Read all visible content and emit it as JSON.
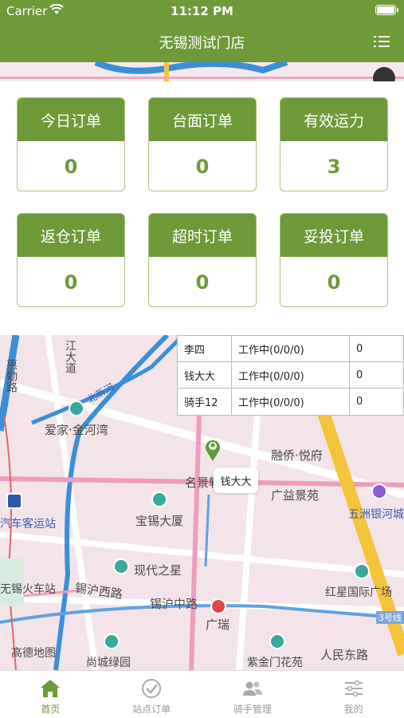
{
  "status_bar": {
    "carrier": "Carrier",
    "time": "11:12 PM"
  },
  "header": {
    "title": "无锡测试门店"
  },
  "stats": [
    {
      "label": "今日订单",
      "value": "0"
    },
    {
      "label": "台面订单",
      "value": "0"
    },
    {
      "label": "有效运力",
      "value": "3"
    },
    {
      "label": "返仓订单",
      "value": "0"
    },
    {
      "label": "超时订单",
      "value": "0"
    },
    {
      "label": "妥投订单",
      "value": "0"
    }
  ],
  "riders": [
    {
      "name": "李四",
      "status": "工作中(0/0/0)",
      "count": "0"
    },
    {
      "name": "钱大大",
      "status": "工作中(0/0/0)",
      "count": "0"
    },
    {
      "name": "骑手12",
      "status": "工作中(0/0/0)",
      "count": "0"
    }
  ],
  "map": {
    "rider_marker_label": "钱大大",
    "logo": "高德地图",
    "places": [
      {
        "text": "惠勤路"
      },
      {
        "text": "江大道"
      },
      {
        "text": "北新河"
      },
      {
        "text": "爱家·金河湾"
      },
      {
        "text": "融侨·悦府"
      },
      {
        "text": "名景轩"
      },
      {
        "text": "广益景苑"
      },
      {
        "text": "五洲银河城"
      },
      {
        "text": "汽车客运站"
      },
      {
        "text": "宝锡大厦"
      },
      {
        "text": "现代之星"
      },
      {
        "text": "无锡火车站"
      },
      {
        "text": "锡沪西路"
      },
      {
        "text": "锡沪中路"
      },
      {
        "text": "广瑞"
      },
      {
        "text": "红星国际广场"
      },
      {
        "text": "3号线"
      },
      {
        "text": "尚城绿园"
      },
      {
        "text": "紫金门花苑"
      },
      {
        "text": "人民东路"
      }
    ]
  },
  "tabs": [
    {
      "label": "首页",
      "active": true
    },
    {
      "label": "站点订单",
      "active": false
    },
    {
      "label": "骑手管理",
      "active": false
    },
    {
      "label": "我的",
      "active": false
    }
  ],
  "colors": {
    "brand": "#6e9a3a",
    "map_bg": "#f3e4ea",
    "river": "#3a8fd8",
    "main_road": "#f5c33b"
  }
}
